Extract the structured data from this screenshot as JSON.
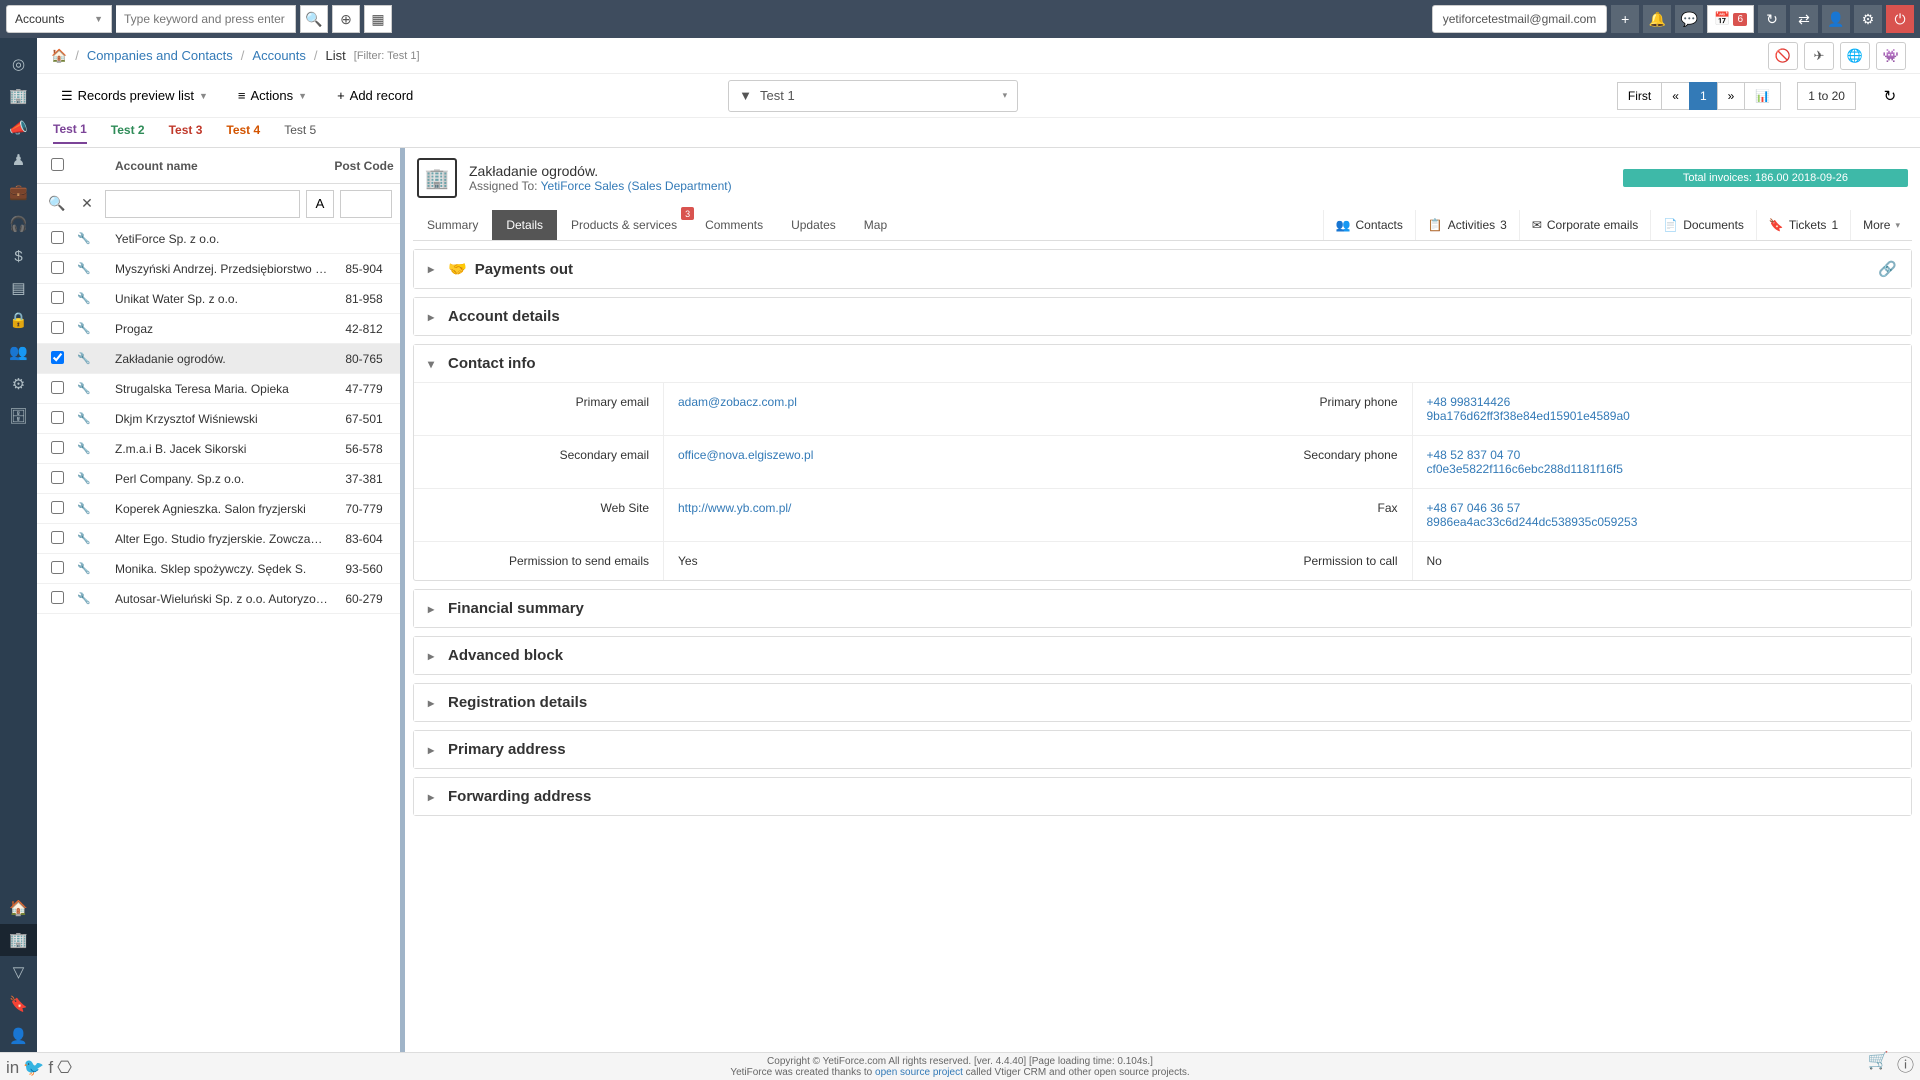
{
  "topbar": {
    "module": "Accounts",
    "search_placeholder": "Type keyword and press enter",
    "email": "yetiforcetestmail@gmail.com",
    "calendar_badge": "6"
  },
  "breadcrumb": {
    "home": "🏠",
    "level1": "Companies and Contacts",
    "level2": "Accounts",
    "level3": "List",
    "filter_label": "[Filter: Test 1]"
  },
  "toolbar": {
    "records_preview": "Records preview list",
    "actions": "Actions",
    "add_record": "Add record",
    "filter_value": "Test 1",
    "page_first": "First",
    "page_prev": "«",
    "page_current": "1",
    "page_next": "»",
    "range": "1 to 20"
  },
  "tabs": [
    {
      "label": "Test 1",
      "cls": "t1"
    },
    {
      "label": "Test 2",
      "cls": "t2"
    },
    {
      "label": "Test 3",
      "cls": "t3"
    },
    {
      "label": "Test 4",
      "cls": "t4"
    },
    {
      "label": "Test 5",
      "cls": "t5"
    }
  ],
  "list": {
    "col_name": "Account name",
    "col_post": "Post Code",
    "rows": [
      {
        "name": "YetiForce Sp. z o.o.",
        "post": ""
      },
      {
        "name": "Myszyński Andrzej. Przedsiębiorstwo hand...",
        "post": "85-904"
      },
      {
        "name": "Unikat Water Sp. z o.o.",
        "post": "81-958"
      },
      {
        "name": "Progaz",
        "post": "42-812"
      },
      {
        "name": "Zakładanie ogrodów.",
        "post": "80-765",
        "selected": true
      },
      {
        "name": "Strugalska Teresa Maria. Opieka",
        "post": "47-779"
      },
      {
        "name": "Dkjm Krzysztof Wiśniewski",
        "post": "67-501"
      },
      {
        "name": "Z.m.a.i B. Jacek Sikorski",
        "post": "56-578"
      },
      {
        "name": "Perl Company. Sp.z o.o.",
        "post": "37-381"
      },
      {
        "name": "Koperek Agnieszka. Salon fryzjerski",
        "post": "70-779"
      },
      {
        "name": "Alter Ego. Studio fryzjerskie. Zowczak A...",
        "post": "83-604"
      },
      {
        "name": "Monika. Sklep spożywczy. Sędek S.",
        "post": "93-560"
      },
      {
        "name": "Autosar-Wieluński Sp. z o.o. Autoryzowan...",
        "post": "60-279"
      }
    ]
  },
  "record": {
    "title": "Zakładanie ogrodów.",
    "assigned_label": "Assigned To:",
    "assigned_to": "YetiForce Sales (Sales Department)",
    "invoices": "Total invoices: 186.00 2018-09-26"
  },
  "rectabs": {
    "left": [
      {
        "label": "Summary"
      },
      {
        "label": "Details",
        "active": true
      },
      {
        "label": "Products & services",
        "badge": "3"
      },
      {
        "label": "Comments"
      },
      {
        "label": "Updates"
      },
      {
        "label": "Map"
      }
    ],
    "right": [
      {
        "icon": "👥",
        "label": "Contacts"
      },
      {
        "icon": "📋",
        "label": "Activities",
        "badge": "3"
      },
      {
        "icon": "✉",
        "label": "Corporate emails"
      },
      {
        "icon": "📄",
        "label": "Documents"
      },
      {
        "icon": "🔖",
        "label": "Tickets",
        "badge": "1"
      },
      {
        "label": "More",
        "caret": true
      }
    ]
  },
  "blocks": {
    "payments_out": "Payments out",
    "account_details": "Account details",
    "contact_info": "Contact info",
    "financial_summary": "Financial summary",
    "advanced_block": "Advanced block",
    "registration_details": "Registration details",
    "primary_address": "Primary address",
    "forwarding_address": "Forwarding address"
  },
  "contact": {
    "primary_email_label": "Primary email",
    "primary_email": "adam@zobacz.com.pl",
    "primary_phone_label": "Primary phone",
    "primary_phone1": "+48 998314426",
    "primary_phone2": "9ba176d62ff3f38e84ed15901e4589a0",
    "secondary_email_label": "Secondary email",
    "secondary_email": "office@nova.elgiszewo.pl",
    "secondary_phone_label": "Secondary phone",
    "secondary_phone1": "+48 52 837 04 70",
    "secondary_phone2": "cf0e3e5822f116c6ebc288d1181f16f5",
    "website_label": "Web Site",
    "website": "http://www.yb.com.pl/",
    "fax_label": "Fax",
    "fax1": "+48 67 046 36 57",
    "fax2": "8986ea4ac33c6d244dc538935c059253",
    "perm_emails_label": "Permission to send emails",
    "perm_emails": "Yes",
    "perm_call_label": "Permission to call",
    "perm_call": "No"
  },
  "footer": {
    "line1": "Copyright © YetiForce.com All rights reserved. [ver. 4.4.40] [Page loading time: 0.104s.]",
    "line2a": "YetiForce was created thanks to ",
    "line2b": "open source project",
    "line2c": " called Vtiger CRM and other open source projects."
  }
}
